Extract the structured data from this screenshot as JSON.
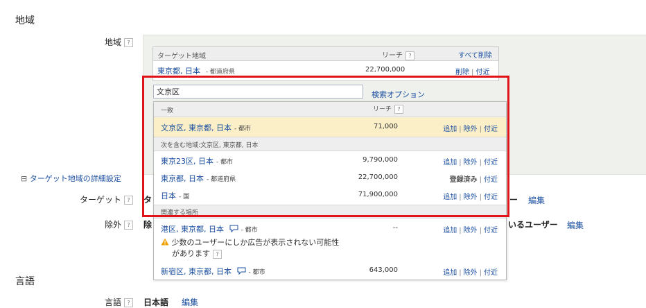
{
  "sections": {
    "region_title": "地域",
    "language_title": "言語"
  },
  "labels": {
    "region": "地域",
    "target": "ターゲット",
    "exclude": "除外",
    "language": "言語",
    "help": "?"
  },
  "advanced": {
    "toggle_icon": "⊟",
    "link": "ターゲット地域の詳細設定",
    "target_value_fragment": "タ",
    "target_tail": "ー",
    "exclude_value_fragment": "除",
    "exclude_tail": "いるユーザー",
    "edit": "編集"
  },
  "language": {
    "value": "日本語",
    "edit": "編集"
  },
  "target_table": {
    "col_region": "ターゲット地域",
    "col_reach": "リーチ",
    "remove_all": "すべて削除",
    "row": {
      "place": "東京都, 日本",
      "kind": "- 都道府県",
      "reach": "22,700,000",
      "remove": "削除",
      "nearby": "付近"
    }
  },
  "search": {
    "value": "文京区",
    "options_link": "検索オプション"
  },
  "dropdown": {
    "match_header": "一致",
    "reach_header": "リーチ",
    "exact": {
      "place": "文京区, 東京都, 日本",
      "kind": "- 都市",
      "reach": "71,000",
      "add": "追加",
      "exclude": "除外",
      "nearby": "付近"
    },
    "contains_header": "次を含む地域:文京区, 東京都, 日本",
    "contains": [
      {
        "place": "東京23区, 日本",
        "kind": "- 都市",
        "reach": "9,790,000",
        "a1": "追加",
        "a2": "除外",
        "a3": "付近"
      },
      {
        "place": "東京都, 日本",
        "kind": "- 都道府県",
        "reach": "22,700,000",
        "a1": "登録済み",
        "a3": "付近"
      },
      {
        "place": "日本",
        "kind": "- 国",
        "reach": "71,900,000",
        "a1": "追加",
        "a2": "除外",
        "a3": "付近"
      }
    ],
    "related_header": "関連する場所",
    "related": [
      {
        "place": "港区, 東京都, 日本",
        "kind": "- 都市",
        "reach": "--",
        "a1": "追加",
        "a2": "除外",
        "a3": "付近",
        "warning_line1": "少数のユーザーにしか広告が表示されない可能性",
        "warning_line2": "があります"
      },
      {
        "place": "新宿区, 東京都, 日本",
        "kind": "- 都市",
        "reach": "643,000",
        "a1": "追加",
        "a2": "除外",
        "a3": "付近"
      }
    ]
  },
  "colors": {
    "link": "#1a4ea0",
    "selected_row": "#fbefc8",
    "highlight": "#e0131a",
    "warning": "#f0a000"
  }
}
